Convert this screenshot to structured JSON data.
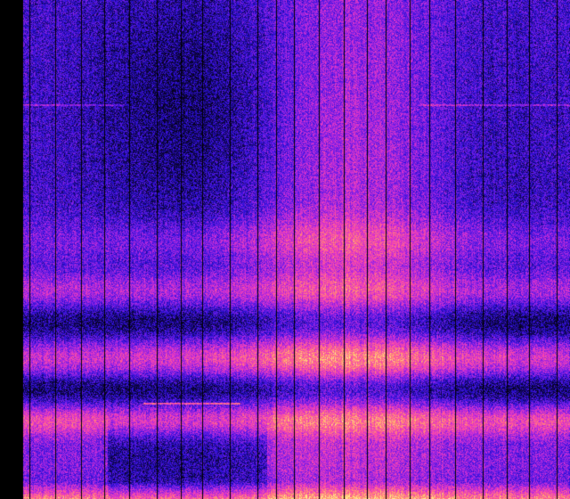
{
  "image": {
    "kind": "waterfall-spectrogram",
    "colormap": {
      "name": "magma-like",
      "stops": [
        "#000000",
        "#0d0440",
        "#2a10d8",
        "#7a1fe6",
        "#d12fd4",
        "#ff4fa0",
        "#ff9a6a",
        "#fff090"
      ]
    },
    "background_color": "#000000",
    "separator_line_color": "#000000",
    "has_text": false
  }
}
